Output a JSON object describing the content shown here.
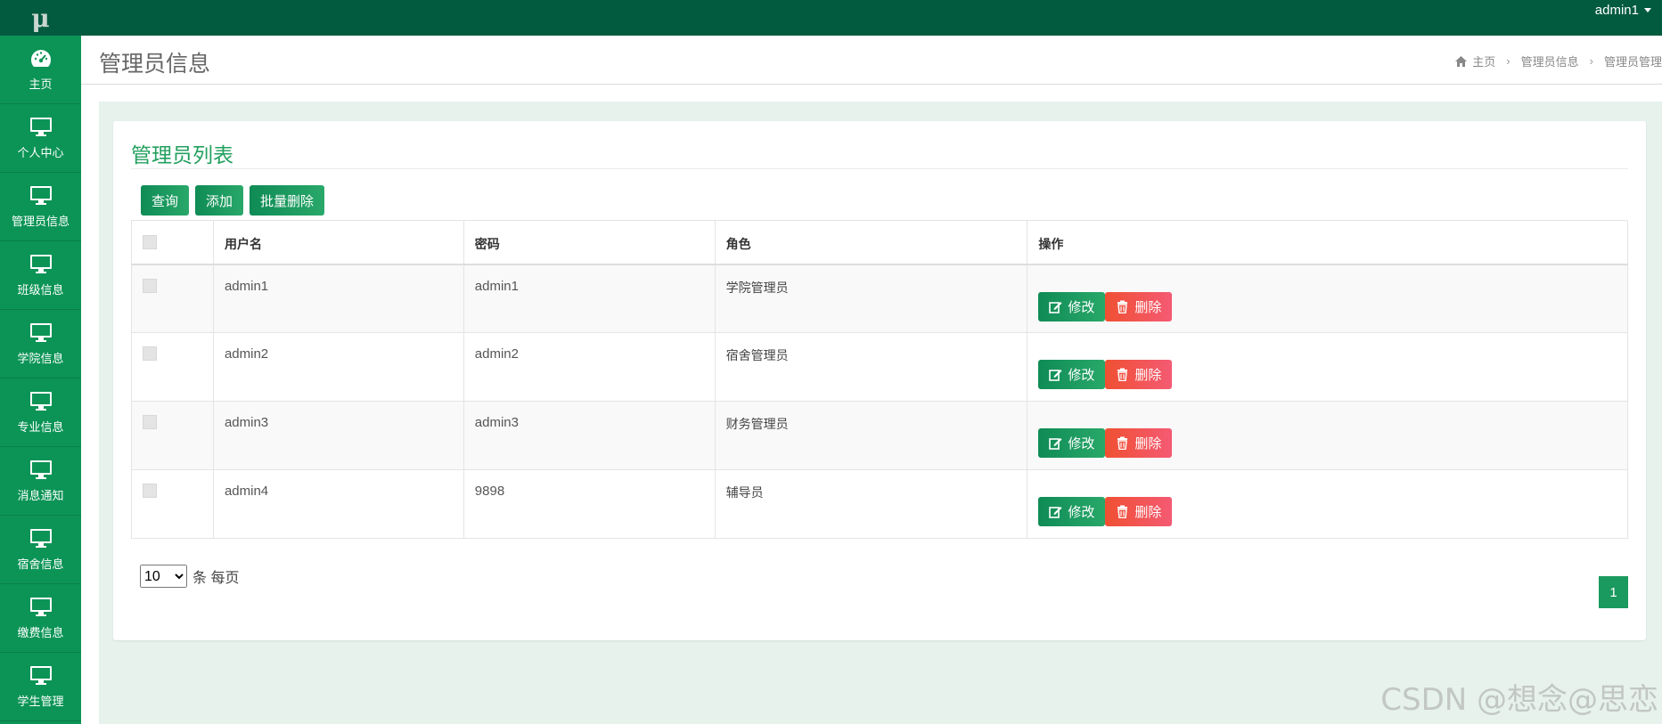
{
  "app": {
    "logo": "μ",
    "user": "admin1"
  },
  "sidebar": {
    "items": [
      {
        "label": "主页",
        "icon": "dashboard-icon"
      },
      {
        "label": "个人中心",
        "icon": "monitor-icon"
      },
      {
        "label": "管理员信息",
        "icon": "monitor-icon"
      },
      {
        "label": "班级信息",
        "icon": "monitor-icon"
      },
      {
        "label": "学院信息",
        "icon": "monitor-icon"
      },
      {
        "label": "专业信息",
        "icon": "monitor-icon"
      },
      {
        "label": "消息通知",
        "icon": "monitor-icon"
      },
      {
        "label": "宿舍信息",
        "icon": "monitor-icon"
      },
      {
        "label": "缴费信息",
        "icon": "monitor-icon"
      },
      {
        "label": "学生管理",
        "icon": "monitor-icon"
      }
    ]
  },
  "header": {
    "title": "管理员信息",
    "breadcrumb": [
      "主页",
      "管理员信息",
      "管理员管理"
    ]
  },
  "card": {
    "title": "管理员列表"
  },
  "toolbar": {
    "query": "查询",
    "add": "添加",
    "batch_delete": "批量删除"
  },
  "table": {
    "headers": [
      "用户名",
      "密码",
      "角色",
      "操作"
    ],
    "rows": [
      {
        "username": "admin1",
        "password": "admin1",
        "role": "学院管理员"
      },
      {
        "username": "admin2",
        "password": "admin2",
        "role": "宿舍管理员"
      },
      {
        "username": "admin3",
        "password": "admin3",
        "role": "财务管理员"
      },
      {
        "username": "admin4",
        "password": "9898",
        "role": "辅导员"
      }
    ],
    "edit_label": "修改",
    "delete_label": "删除"
  },
  "pagination": {
    "page_size": "10",
    "per_page_label": "条 每页",
    "current_page": "1"
  },
  "watermark": "CSDN @想念@思恋",
  "colors": {
    "topbar": "#025b3f",
    "sidebar": "#0b9456",
    "accent": "#23a05f",
    "danger": "#f05032"
  }
}
